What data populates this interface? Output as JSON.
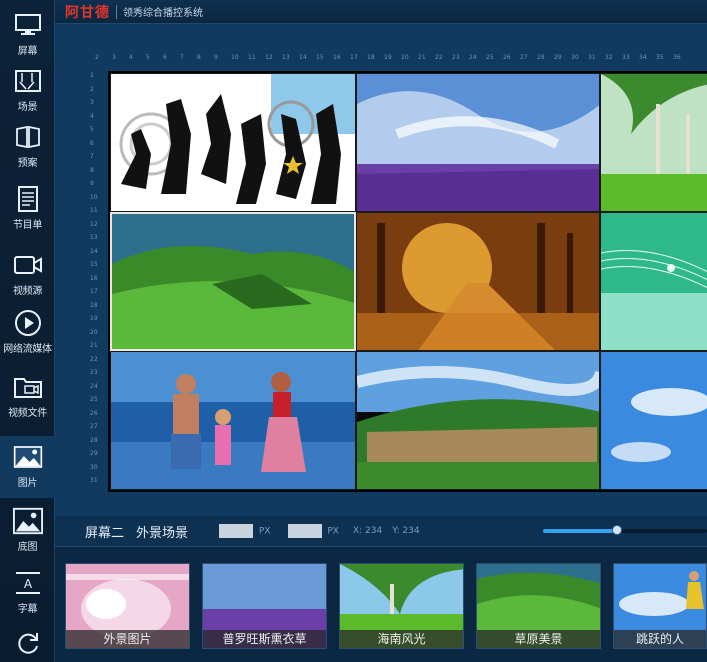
{
  "app": {
    "logo": "阿甘德",
    "title": "领秀综合播控系统"
  },
  "sidebar": {
    "items": [
      {
        "label": "屏幕",
        "icon": "monitor-icon"
      },
      {
        "label": "场景",
        "icon": "scene-icon"
      },
      {
        "label": "预案",
        "icon": "book-icon"
      },
      {
        "label": "节目单",
        "icon": "document-icon"
      },
      {
        "label": "视频源",
        "icon": "camera-icon"
      },
      {
        "label": "网络流媒体",
        "icon": "play-icon"
      },
      {
        "label": "视频文件",
        "icon": "video-folder-icon"
      },
      {
        "label": "图片",
        "icon": "image-icon"
      },
      {
        "label": "底图",
        "icon": "background-image-icon"
      },
      {
        "label": "字幕",
        "icon": "subtitle-icon"
      },
      {
        "label": "",
        "icon": "refresh-icon"
      }
    ],
    "active_index": 7
  },
  "ruler": {
    "h_ticks": [
      "2",
      "3",
      "4",
      "5",
      "6",
      "7",
      "8",
      "9",
      "10",
      "11",
      "12",
      "13",
      "14",
      "15",
      "16",
      "17",
      "18",
      "19",
      "20",
      "21",
      "22",
      "23",
      "24",
      "25",
      "26",
      "27",
      "28",
      "29",
      "30",
      "31",
      "32",
      "33",
      "34",
      "35",
      "36"
    ],
    "v_ticks": [
      "1",
      "2",
      "3",
      "4",
      "5",
      "6",
      "7",
      "8",
      "9",
      "10",
      "11",
      "12",
      "13",
      "14",
      "15",
      "16",
      "17",
      "18",
      "19",
      "20",
      "21",
      "22",
      "23",
      "24",
      "25",
      "26",
      "27",
      "28",
      "29",
      "30",
      "31"
    ]
  },
  "status": {
    "screen_name": "屏幕二",
    "scene_name": "外景场景",
    "width_unit": "PX",
    "height_unit": "PX",
    "x_label": "X: 234",
    "y_label": "Y: 234",
    "zoom_level": 0.45
  },
  "thumbnails": [
    {
      "label": "外景图片",
      "icon": "thumbnail-woman-image"
    },
    {
      "label": "普罗旺斯熏衣草",
      "icon": "thumbnail-lavender-image"
    },
    {
      "label": "海南风光",
      "icon": "thumbnail-palm-beach-image"
    },
    {
      "label": "草原美景",
      "icon": "thumbnail-grassland-image"
    },
    {
      "label": "跳跃的人",
      "icon": "thumbnail-jumping-person-image"
    }
  ]
}
